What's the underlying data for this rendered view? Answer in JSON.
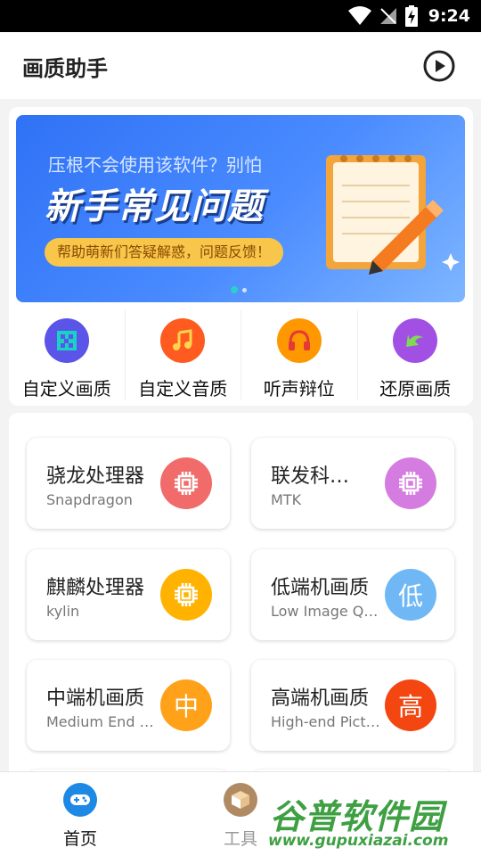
{
  "status_bar": {
    "time": "9:24"
  },
  "app_bar": {
    "title": "画质助手",
    "play_icon": "play-circle-icon"
  },
  "banner": {
    "subtitle": "压根不会使用该软件？别怕",
    "headline": "新手常见问题",
    "pill": "帮助萌新们答疑解惑，问题反馈！",
    "page_count": 2,
    "active_page": 1
  },
  "quick_actions": [
    {
      "label": "自定义画质",
      "icon": "image-quality-icon",
      "color": "#5b54e8"
    },
    {
      "label": "自定义音质",
      "icon": "music-note-icon",
      "color": "#ff5a1f"
    },
    {
      "label": "听声辩位",
      "icon": "headphones-icon",
      "color": "#ff9800"
    },
    {
      "label": "还原画质",
      "icon": "undo-arrow-icon",
      "color": "#a24fe3"
    }
  ],
  "tiles": [
    {
      "title": "骁龙处理器",
      "subtitle": "Snapdragon",
      "icon": "chip-icon",
      "badge": "",
      "color": "#f16b6b"
    },
    {
      "title": "联发科处理器",
      "subtitle": "MTK",
      "icon": "chip-icon",
      "badge": "",
      "color": "#d57ce0"
    },
    {
      "title": "麒麟处理器",
      "subtitle": "kylin",
      "icon": "chip-icon",
      "badge": "",
      "color": "#ffb300"
    },
    {
      "title": "低端机画质",
      "subtitle": "Low Image Quality",
      "icon": "text-badge",
      "badge": "低",
      "color": "#6fb8f5"
    },
    {
      "title": "中端机画质",
      "subtitle": "Medium End Picture",
      "icon": "text-badge",
      "badge": "中",
      "color": "#ffa21a"
    },
    {
      "title": "高端机画质",
      "subtitle": "High-end Picture",
      "icon": "text-badge",
      "badge": "高",
      "color": "#f44611"
    }
  ],
  "bottom_nav": [
    {
      "label": "首页",
      "icon": "gamepad-icon",
      "active": true,
      "color": "#1e88e5"
    },
    {
      "label": "工具",
      "icon": "box-icon",
      "active": false,
      "color": "#b08a63"
    }
  ],
  "watermark": {
    "brand": "谷普软件园",
    "url": "www.gupuxiazai.com"
  }
}
